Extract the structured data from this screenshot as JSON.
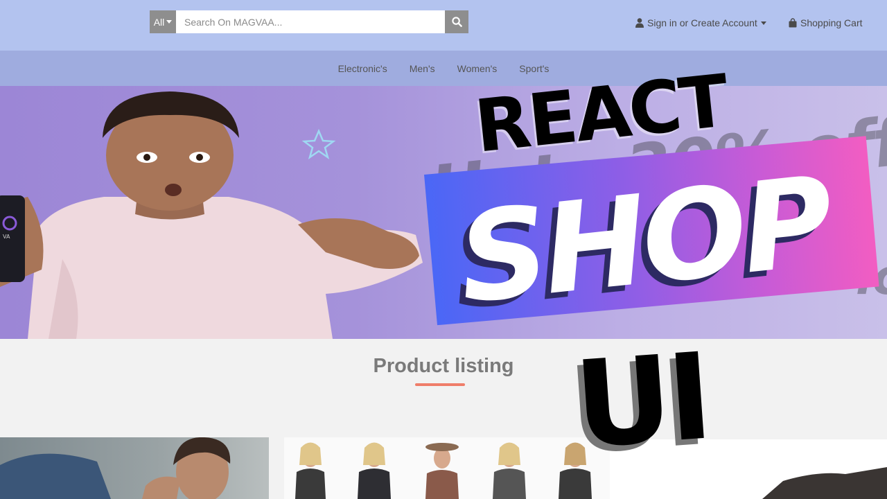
{
  "header": {
    "search": {
      "category_label": "All",
      "placeholder": "Search On MAGVAA...",
      "value": ""
    },
    "account_label": "Sign in or Create Account",
    "cart_label": "Shopping Cart"
  },
  "nav": {
    "items": [
      "Electronic's",
      "Men's",
      "Women's",
      "Sport's"
    ]
  },
  "hero": {
    "promo_text": "Upto 30% off",
    "promo_text_2": "ic",
    "phone_logo_text": "VA"
  },
  "listing": {
    "title": "Product listing"
  },
  "overlay": {
    "line1": "REACT",
    "line2": "SHOP",
    "line3": "UI"
  },
  "colors": {
    "topbar": "#b3c3ef",
    "catnav": "#9facdf",
    "accent_underline": "#ef7e6a",
    "band_start": "#4a67f6",
    "band_end": "#f25dc2"
  }
}
